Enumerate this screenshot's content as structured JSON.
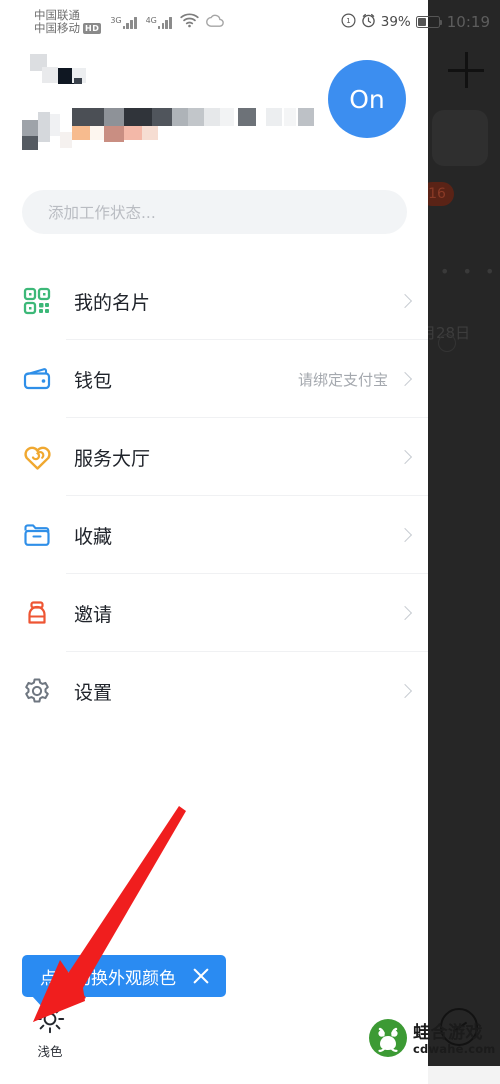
{
  "status_bar": {
    "carrier_primary": "中国联通",
    "carrier_secondary": "中国移动",
    "hd_badge": "HD",
    "net_label_1": "3G",
    "net_label_2": "4G",
    "wifi_icon": "wifi-icon",
    "cloud_icon": "cloud-icon",
    "dnd_icon": "do-not-disturb-icon",
    "alarm_icon": "alarm-icon",
    "battery_percent": "39%",
    "clock": "10:19"
  },
  "profile": {
    "name_redacted": "",
    "subtitle_redacted": "",
    "on_button_label": "On"
  },
  "work_status": {
    "placeholder": "添加工作状态...",
    "value": ""
  },
  "menu": {
    "items": [
      {
        "label": "我的名片",
        "value": "",
        "icon": "qr-code-icon",
        "color": "#3cb878"
      },
      {
        "label": "钱包",
        "value": "请绑定支付宝",
        "icon": "wallet-icon",
        "color": "#2f8fe8"
      },
      {
        "label": "服务大厅",
        "value": "",
        "icon": "heart-service-icon",
        "color": "#f0a830"
      },
      {
        "label": "收藏",
        "value": "",
        "icon": "folder-star-icon",
        "color": "#2f8fe8"
      },
      {
        "label": "邀请",
        "value": "",
        "icon": "invite-box-icon",
        "color": "#ee5533"
      },
      {
        "label": "设置",
        "value": "",
        "icon": "gear-icon",
        "color": "#6e7680"
      }
    ]
  },
  "appearance": {
    "sun_icon": "sun-icon",
    "mode_label": "浅色"
  },
  "tooltip": {
    "text": "点击切换外观颜色",
    "close_icon": "close-icon",
    "background_color": "#2a8bf2"
  },
  "annotation": {
    "arrow_icon": "red-arrow-icon",
    "arrow_color": "#f01e1e"
  },
  "background_app": {
    "add_icon": "plus-icon",
    "unread_badge": "16",
    "more_dots": "• • •",
    "date_fragment": "月28日",
    "refresh_icon": "refresh-icon",
    "compose_icon": "compose-icon"
  },
  "watermark": {
    "logo_icon": "frog-leaf-logo-icon",
    "title": "蛙合游戏",
    "url": "cdwahe.com",
    "logo_color": "#3c9a34"
  }
}
